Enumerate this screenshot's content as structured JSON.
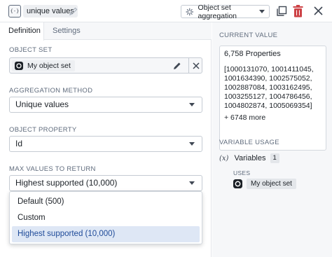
{
  "header": {
    "variable_name": "unique values",
    "variable_type": "Object set aggregation"
  },
  "tabs": [
    {
      "label": "Definition"
    },
    {
      "label": "Settings"
    }
  ],
  "object_set": {
    "label": "OBJECT SET",
    "value": "My object set"
  },
  "aggregation_method": {
    "label": "AGGREGATION METHOD",
    "value": "Unique values"
  },
  "object_property": {
    "label": "OBJECT PROPERTY",
    "value": "Id"
  },
  "max_values": {
    "label": "MAX VALUES TO RETURN",
    "value": "Highest supported (10,000)",
    "options": [
      {
        "label": "Default (500)"
      },
      {
        "label": "Custom"
      },
      {
        "label": "Highest supported (10,000)"
      }
    ]
  },
  "current_value": {
    "label": "CURRENT VALUE",
    "count": "6,758 Properties",
    "ids": [
      "[1000131070, 1001411045,",
      "1001634390, 1002575052,",
      "1002887084, 1003162495,",
      "1003255127, 1004786456,",
      "1004802874, 1005069354]"
    ],
    "more": "+ 6748 more"
  },
  "variable_usage": {
    "label": "VARIABLE USAGE",
    "variables_label": "Variables",
    "variables_count": "1",
    "uses_label": "USES",
    "uses_item": "My object set"
  },
  "colors": {
    "accent_selected": "#dee7f5",
    "accent_text": "#1f4b99",
    "danger": "#cd4246"
  }
}
